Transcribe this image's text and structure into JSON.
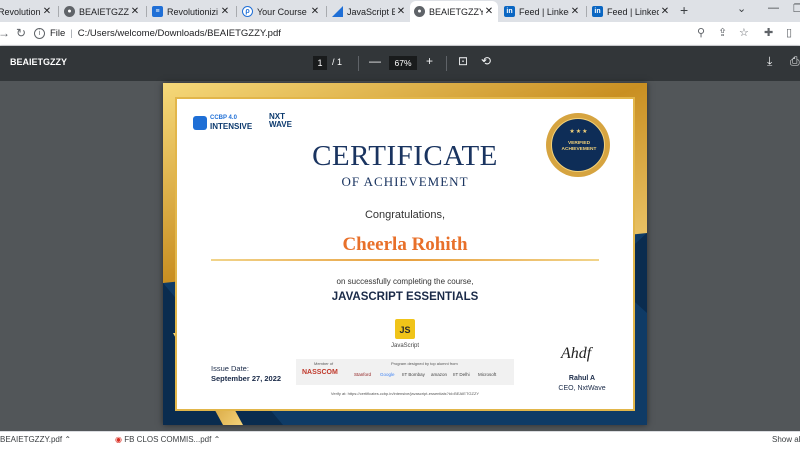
{
  "browser": {
    "tabs": [
      {
        "title": "Revolutionizi",
        "icon": "favicon-icon",
        "color": "#c9302c"
      },
      {
        "title": "BEAIETGZZY",
        "icon": "globe-icon",
        "color": "#5f6368"
      },
      {
        "title": "Revolutionizi",
        "icon": "favicon-icon",
        "color": "#1f6fd6"
      },
      {
        "title": "Your Course C",
        "icon": "favicon-icon",
        "color": "#1f6fd6"
      },
      {
        "title": "JavaScript Ess",
        "icon": "favicon-icon",
        "color": "#1f6fd6"
      },
      {
        "title": "BEAIETGZZY",
        "icon": "globe-icon",
        "color": "#5f6368",
        "active": true
      },
      {
        "title": "Feed | Linked",
        "icon": "linkedin-icon",
        "color": "#0a66c2"
      },
      {
        "title": "Feed | Linked",
        "icon": "linkedin-icon",
        "color": "#0a66c2"
      }
    ],
    "new_tab_label": "+",
    "address": {
      "scheme_label": "File",
      "path": "C:/Users/welcome/Downloads/BEAIETGZZY.pdf"
    }
  },
  "pdf_viewer": {
    "title": "BEAIETGZZY",
    "page_current": "1",
    "page_total": "/ 1",
    "zoom": "67%"
  },
  "certificate": {
    "logo_ccbp_line1": "CCBP 4.0",
    "logo_ccbp_line2": "INTENSIVE",
    "logo_nxt_line1": "NXT",
    "logo_nxt_line2": "WAVE",
    "title": "CERTIFICATE",
    "subtitle": "OF ACHIEVEMENT",
    "congrats": "Congratulations,",
    "recipient": "Cheerla Rohith",
    "completion_text": "on successfully completing the course,",
    "course": "JAVASCRIPT ESSENTIALS",
    "course_badge": "JS",
    "course_badge_label": "JavaScript",
    "issue_label": "Issue Date:",
    "issue_date": "September 27, 2022",
    "member_label": "Member of",
    "nasscom": "NASSCOM",
    "designed_label": "Program designed by top alumni from",
    "partners": [
      "Stanford",
      "Google",
      "IIT Bombay",
      "amazon",
      "IIT Delhi",
      "Microsoft"
    ],
    "verify_text": "Verify at: https://certificates.ccbp.in/intensive/javascript-essentials?id=BEAIETGZZY",
    "signature": "Ahdf",
    "signer_name": "Rahul A",
    "signer_title": "CEO, NxtWave",
    "seal_top": "VERIFIED",
    "seal_bottom": "ACHIEVEMENT",
    "seal_stars": "★★★"
  },
  "downloads": [
    {
      "name": "BEAIETGZZY.pdf"
    },
    {
      "name": "FB CLOS COMMIS...pdf"
    }
  ],
  "download_show_all": "Show all"
}
